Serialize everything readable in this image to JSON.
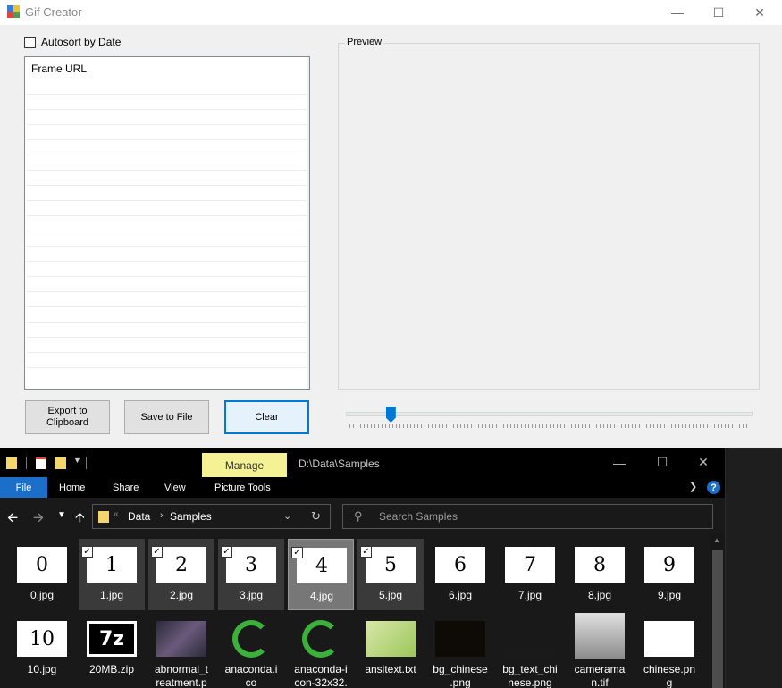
{
  "gif_creator": {
    "title": "Gif Creator",
    "autosort_label": "Autosort by Date",
    "autosort_checked": false,
    "list_header": "Frame URL",
    "preview_label": "Preview",
    "buttons": {
      "export": "Export to\nClipboard",
      "save": "Save to File",
      "clear": "Clear"
    },
    "slider_value": 0.11
  },
  "explorer": {
    "contextual_tab": "Manage",
    "title": "D:\\Data\\Samples",
    "ribbon_tabs": [
      "File",
      "Home",
      "Share",
      "View",
      "Picture Tools"
    ],
    "address": [
      "Data",
      "Samples"
    ],
    "search_placeholder": "Search Samples",
    "help": "?",
    "files": [
      {
        "name": "0.jpg",
        "thumb": "0"
      },
      {
        "name": "1.jpg",
        "thumb": "1"
      },
      {
        "name": "2.jpg",
        "thumb": "2"
      },
      {
        "name": "3.jpg",
        "thumb": "3"
      },
      {
        "name": "4.jpg",
        "thumb": "4"
      },
      {
        "name": "5.jpg",
        "thumb": "5"
      },
      {
        "name": "6.jpg",
        "thumb": "6"
      },
      {
        "name": "7.jpg",
        "thumb": "7"
      },
      {
        "name": "8.jpg",
        "thumb": "8"
      },
      {
        "name": "9.jpg",
        "thumb": "9"
      },
      {
        "name": "10.jpg",
        "thumb": "10"
      },
      {
        "name": "20MB.zip",
        "thumb": "7z"
      },
      {
        "name": "abnormal_t\nreatment.p",
        "thumb": ""
      },
      {
        "name": "anaconda.i\nco",
        "thumb": ""
      },
      {
        "name": "anaconda-i\ncon-32x32.",
        "thumb": ""
      },
      {
        "name": "ansitext.txt",
        "thumb": ""
      },
      {
        "name": "bg_chinese\n.png",
        "thumb": ""
      },
      {
        "name": "bg_text_chi\nnese.png",
        "thumb": ""
      },
      {
        "name": "camerama\nn.tif",
        "thumb": ""
      },
      {
        "name": "chinese.pn\ng",
        "thumb": ""
      }
    ]
  }
}
